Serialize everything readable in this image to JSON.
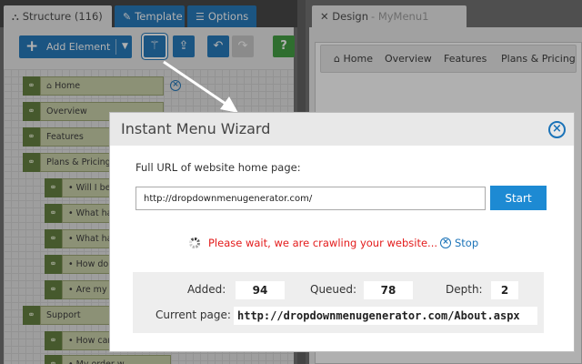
{
  "left_panel": {
    "tabs": [
      {
        "label": "Structure (116)",
        "icon": "sitemap-icon"
      },
      {
        "label": "Template",
        "icon": "brush-icon"
      },
      {
        "label": "Options",
        "icon": "list-icon"
      }
    ],
    "toolbar": {
      "add_element_label": "Add Element",
      "buttons": [
        "magic-wand-icon",
        "import-icon",
        "undo-icon",
        "redo-icon",
        "help-icon"
      ],
      "help_glyph": "?"
    },
    "tree": [
      {
        "label": "Home",
        "level": 0,
        "home_icon": "⌂"
      },
      {
        "label": "Overview",
        "level": 0
      },
      {
        "label": "Features",
        "level": 0
      },
      {
        "label": "Plans & Pricing",
        "level": 0
      },
      {
        "label": "• Will I be c",
        "level": 1
      },
      {
        "label": "• What happ",
        "level": 1
      },
      {
        "label": "• What happ",
        "level": 1
      },
      {
        "label": "• How do I p",
        "level": 1
      },
      {
        "label": "• Are my cre",
        "level": 1
      },
      {
        "label": "Support",
        "level": 0
      },
      {
        "label": "• How can I",
        "level": 1
      },
      {
        "label": "• My order w",
        "level": 1
      }
    ]
  },
  "right_panel": {
    "tab_label": "Design",
    "tab_sub": "- MyMenu1",
    "menu_items": [
      "Home",
      "Overview",
      "Features",
      "Plans & Pricing"
    ]
  },
  "dialog": {
    "title": "Instant Menu Wizard",
    "url_label": "Full URL of website home page:",
    "url_value": "http://dropdownmenugenerator.com/",
    "start_label": "Start",
    "wait_message": "Please wait, we are crawling your website...",
    "stop_label": "Stop",
    "stats": {
      "added_label": "Added:",
      "added_value": "94",
      "queued_label": "Queued:",
      "queued_value": "78",
      "depth_label": "Depth:",
      "depth_value": "2",
      "current_label": "Current page:",
      "current_value": "http://dropdownmenugenerator.com/About.aspx"
    }
  },
  "colors": {
    "accent": "#1b73b8",
    "start_button": "#1d8ad3",
    "error_text": "#e31b1b",
    "tree_link": "#5c7a37",
    "tree_node": "#c8cfa6",
    "help_button": "#3a9a3a"
  }
}
